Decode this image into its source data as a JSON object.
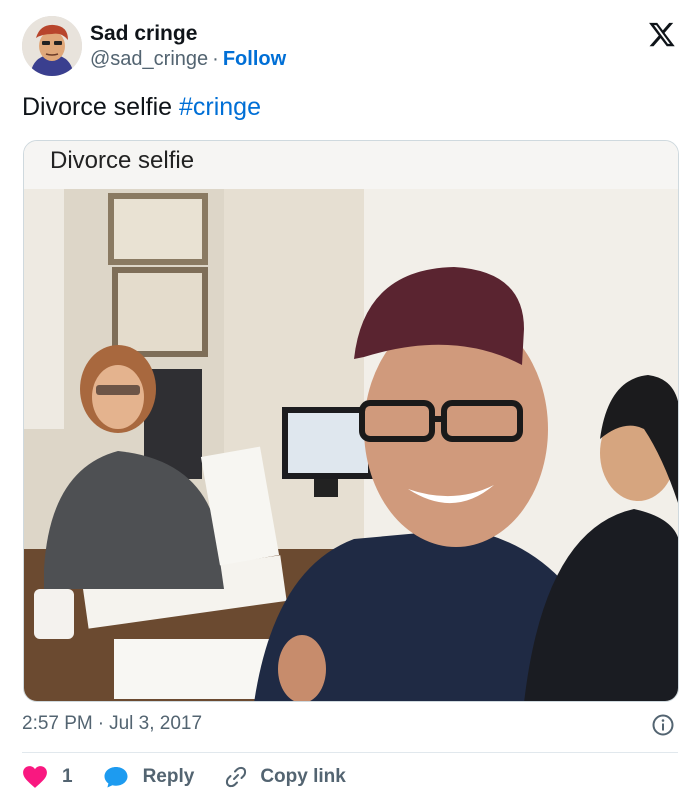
{
  "author": {
    "name": "Sad cringe",
    "handle": "@sad_cringe",
    "separator": "·",
    "follow_label": "Follow"
  },
  "tweet": {
    "text": "Divorce selfie ",
    "hashtag": "#cringe"
  },
  "media": {
    "caption": "Divorce selfie"
  },
  "footer": {
    "time": "2:57 PM",
    "separator": "·",
    "date": "Jul 3, 2017"
  },
  "actions": {
    "like_count": "1",
    "reply_label": "Reply",
    "copy_link_label": "Copy link"
  },
  "icons": {
    "brand": "x-logo-icon",
    "info": "info-icon",
    "like": "heart-icon",
    "reply": "speech-bubble-icon",
    "copy": "link-icon"
  },
  "colors": {
    "link": "#006fd6",
    "heart": "#f91880",
    "reply": "#1d9bf0",
    "secondary_text": "#536471"
  }
}
